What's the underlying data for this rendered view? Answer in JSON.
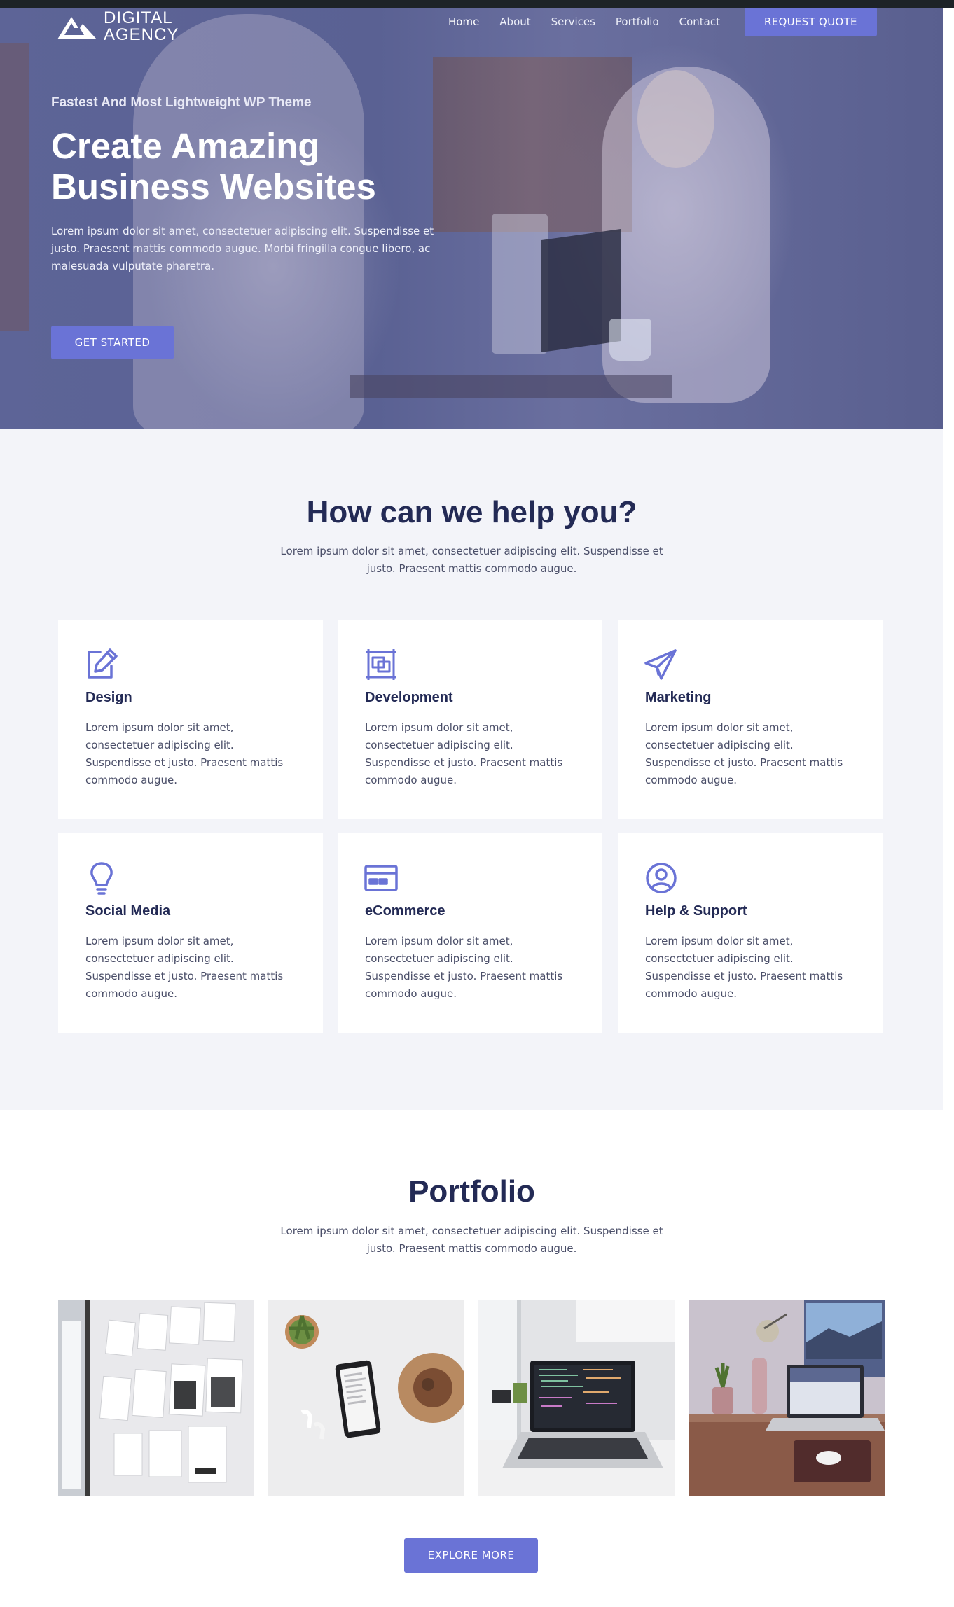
{
  "site": {
    "logo_line1": "DIGITAL",
    "logo_line2": "AGENCY"
  },
  "nav": {
    "items": [
      "Home",
      "About",
      "Services",
      "Portfolio",
      "Contact"
    ],
    "quote_button": "REQUEST QUOTE"
  },
  "hero": {
    "tagline": "Fastest And Most Lightweight WP Theme",
    "title_line1": "Create Amazing",
    "title_line2": "Business Websites",
    "text": "Lorem ipsum dolor sit amet, consectetuer adipiscing elit. Suspendisse et justo. Praesent mattis commodo augue. Morbi fringilla congue libero, ac malesuada vulputate pharetra.",
    "button": "GET STARTED"
  },
  "help": {
    "title": "How can we help you?",
    "subtitle": "Lorem ipsum dolor sit amet, consectetuer adipiscing elit. Suspendisse et justo. Praesent mattis commodo augue.",
    "cards": [
      {
        "icon": "edit-icon",
        "title": "Design",
        "text": "Lorem ipsum dolor sit amet, consectetuer adipiscing elit. Suspendisse et justo. Praesent mattis commodo augue."
      },
      {
        "icon": "layers-icon",
        "title": "Development",
        "text": "Lorem ipsum dolor sit amet, consectetuer adipiscing elit. Suspendisse et justo. Praesent mattis commodo augue."
      },
      {
        "icon": "paper-plane-icon",
        "title": "Marketing",
        "text": "Lorem ipsum dolor sit amet, consectetuer adipiscing elit. Suspendisse et justo. Praesent mattis commodo augue."
      },
      {
        "icon": "lightbulb-icon",
        "title": "Social Media",
        "text": "Lorem ipsum dolor sit amet, consectetuer adipiscing elit. Suspendisse et justo. Praesent mattis commodo augue."
      },
      {
        "icon": "credit-card-icon",
        "title": "eCommerce",
        "text": "Lorem ipsum dolor sit amet, consectetuer adipiscing elit. Suspendisse et justo. Praesent mattis commodo augue."
      },
      {
        "icon": "user-circle-icon",
        "title": "Help & Support",
        "text": "Lorem ipsum dolor sit amet, consectetuer adipiscing elit. Suspendisse et justo. Praesent mattis commodo augue."
      }
    ]
  },
  "portfolio": {
    "title": "Portfolio",
    "subtitle": "Lorem ipsum dolor sit amet, consectetuer adipiscing elit. Suspendisse et justo. Praesent mattis commodo augue.",
    "button": "EXPLORE MORE"
  },
  "colors": {
    "accent": "#6a73d6",
    "heading": "#232a55",
    "section_bg": "#f3f4f9"
  }
}
